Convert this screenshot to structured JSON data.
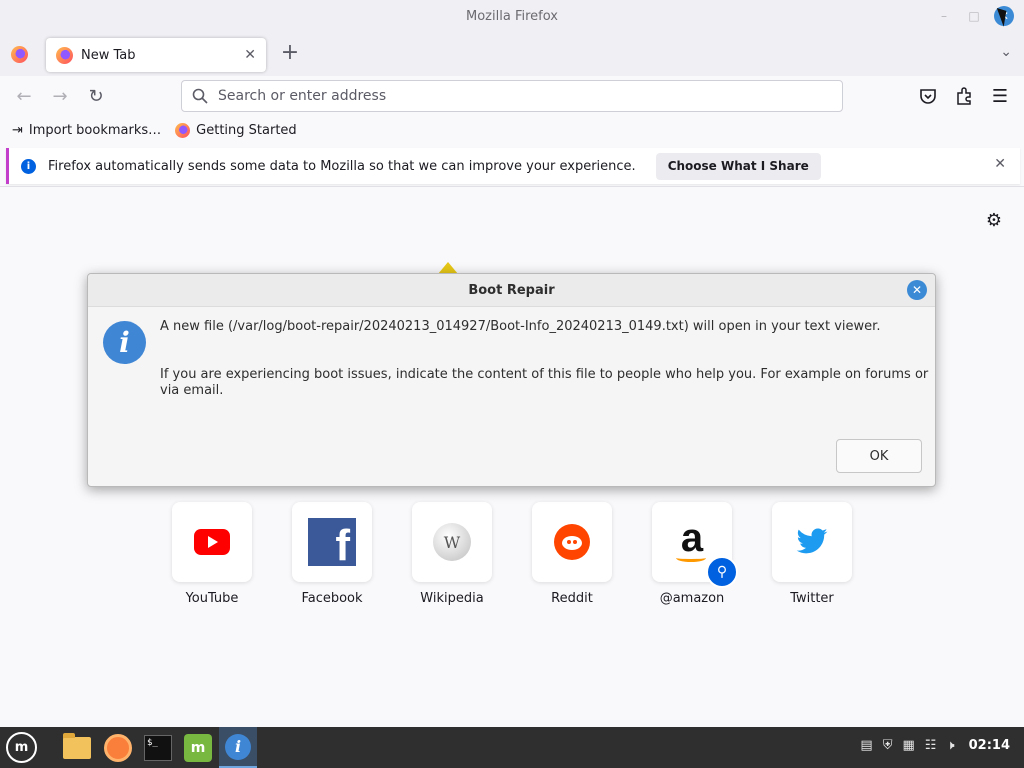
{
  "window": {
    "title": "Mozilla Firefox"
  },
  "tabs": [
    {
      "label": "New Tab"
    }
  ],
  "urlbar": {
    "placeholder": "Search or enter address"
  },
  "bookmarks": [
    {
      "label": "Import bookmarks…"
    },
    {
      "label": "Getting Started"
    }
  ],
  "notification": {
    "text": "Firefox automatically sends some data to Mozilla so that we can improve your experience.",
    "button": "Choose What I Share"
  },
  "top_sites": [
    {
      "label": "YouTube"
    },
    {
      "label": "Facebook"
    },
    {
      "label": "Wikipedia"
    },
    {
      "label": "Reddit"
    },
    {
      "label": "@amazon"
    },
    {
      "label": "Twitter"
    }
  ],
  "dialog": {
    "title": "Boot Repair",
    "line1": "A new file (/var/log/boot-repair/20240213_014927/Boot-Info_20240213_0149.txt) will open in your text viewer.",
    "line2": "If you are experiencing boot issues, indicate the content of this file to people who help you. For example on forums or via email.",
    "ok_label": "OK"
  },
  "taskbar": {
    "clock": "02:14"
  },
  "icons": {
    "amazon_glyph": "a",
    "wiki_glyph": "W",
    "facebook_glyph": "f",
    "mint_glyph": "m",
    "info_glyph": "i",
    "terminal_glyph": "$_"
  }
}
